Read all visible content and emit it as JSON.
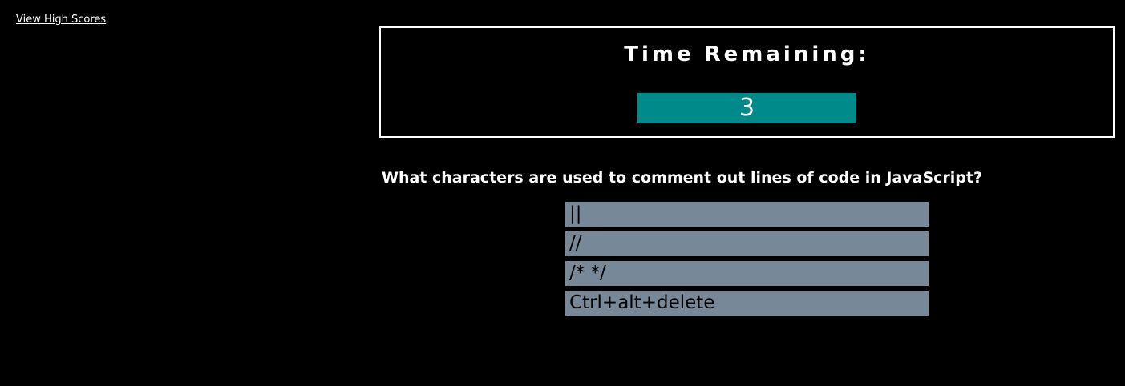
{
  "nav": {
    "high_scores_label": "View High Scores"
  },
  "timer": {
    "label": "Time Remaining:",
    "value": "3"
  },
  "quiz": {
    "question": "What characters are used to comment out lines of code in JavaScript?",
    "answers": [
      {
        "label": "||"
      },
      {
        "label": "//"
      },
      {
        "label": "/* */"
      },
      {
        "label": "Ctrl+alt+delete"
      }
    ]
  },
  "colors": {
    "background": "#000000",
    "timer_fill": "#008b8b",
    "answer_fill": "#778899",
    "text": "#ffffff"
  }
}
